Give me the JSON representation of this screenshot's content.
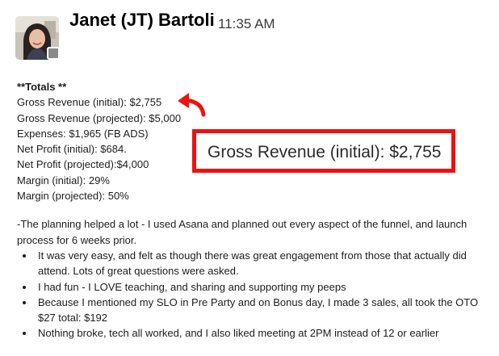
{
  "header": {
    "author": "Janet (JT) Bartoli",
    "timestamp": "11:35 AM"
  },
  "message": {
    "heading": "**Totals **",
    "lines": [
      "Gross Revenue (initial): $2,755",
      "Gross Revenue (projected): $5,000",
      "Expenses: $1,965 (FB ADS)",
      "Net Profit (initial): $684.",
      "Net Profit (projected):$4,000",
      "Margin (initial): 29%",
      "Margin (projected): 50%"
    ],
    "intro": "-The planning helped a lot - I used Asana and planned out every aspect of the funnel, and launch process for 6 weeks prior.",
    "bullets": [
      "It was very easy, and felt as though there was great engagement from those that actually did attend. Lots of great questions were asked.",
      "I had fun - I LOVE teaching, and sharing and supporting my peeps",
      "Because I mentioned my SLO in Pre Party and on Bonus day, I made 3 sales, all took the OTO $27 total: $192",
      "Nothing broke, tech all worked, and I also liked meeting at 2PM instead of 12 or earlier"
    ]
  },
  "callout": {
    "text": "Gross Revenue (initial): $2,755",
    "color": "#ee1111"
  },
  "icons": {
    "status": "status-square-icon",
    "arrow": "curved-arrow-icon"
  }
}
